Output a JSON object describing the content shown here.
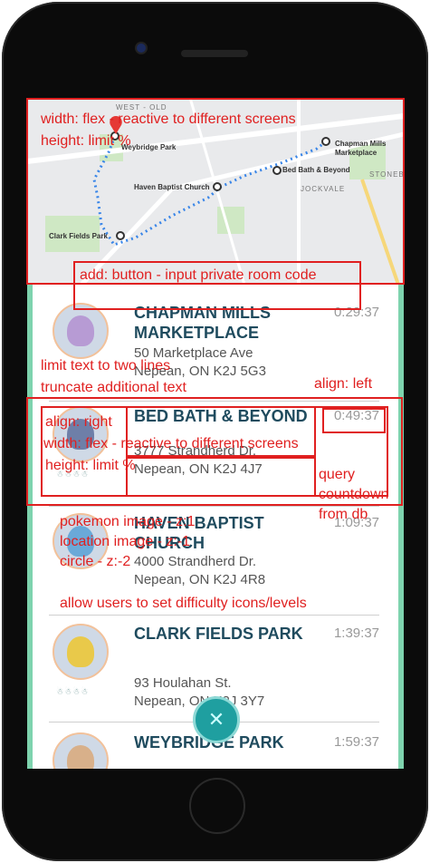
{
  "map": {
    "labels": {
      "west_old": "WEST - OLD",
      "weybridge": "Weybridge Park",
      "chapman": "Chapman Mills Marketplace",
      "bedbath": "Bed Bath & Beyond",
      "haven": "Haven Baptist Church",
      "jockvale": "JOCKVALE",
      "stonebr": "STONEBI",
      "clark": "Clark Fields Park"
    },
    "button_label": "add: button - input private room code"
  },
  "locations": [
    {
      "name": "CHAPMAN MILLS MARKETPLACE",
      "addr1": "50 Marketplace Ave",
      "addr2": "Nepean, ON K2J 5G3",
      "time": "0:29:37"
    },
    {
      "name": "BED BATH & BEYOND",
      "addr1": "3777 Strandherd Dr.",
      "addr2": "Nepean, ON K2J 4J7",
      "time": "0:49:37"
    },
    {
      "name": "HAVEN BAPTIST CHURCH",
      "addr1": "4000 Strandherd Dr.",
      "addr2": "Nepean, ON K2J 4R8",
      "time": "1:09:37"
    },
    {
      "name": "CLARK FIELDS PARK",
      "addr1": "93 Houlahan St.",
      "addr2": "Nepean, ON K2J 3Y7",
      "time": "1:39:37"
    },
    {
      "name": "WEYBRIDGE PARK",
      "addr1": "",
      "addr2": "",
      "time": "1:59:37"
    }
  ],
  "difficulty_icons": "☃☃☃☃",
  "fab_icon": "close-icon",
  "annotations": {
    "map_width": "width: flex - reactive to different screens",
    "map_height": "height: limit %",
    "limit_text": "limit text to two lines",
    "truncate_text": "truncate additional text",
    "align_left": "align: left",
    "align_right": "align: right",
    "row_width": "width: flex - reactive to different screens",
    "row_height": "height: limit %",
    "query": "query",
    "countdown": "countdown",
    "from_db": "from db",
    "pokemon_z": "pokemon image - z:1",
    "location_z": "location image - z:-1",
    "circle_z": "circle - z:-2",
    "difficulty": "allow users to set difficulty icons/levels"
  },
  "colors": {
    "accent": "#7ed3ae",
    "title": "#1f4b5e",
    "annotation": "#e02020",
    "fab": "#1f9fa0"
  }
}
